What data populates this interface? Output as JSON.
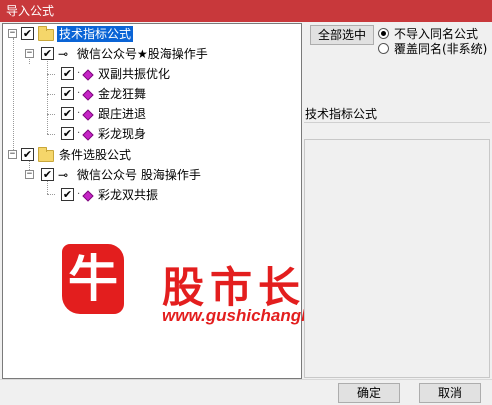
{
  "window": {
    "title": "导入公式"
  },
  "tree": {
    "root1": {
      "label": "技术指标公式",
      "expander": "−",
      "checked": "✔"
    },
    "group1": {
      "label": "微信公众号★股海操作手",
      "expander": "−",
      "checked": "✔"
    },
    "items1": [
      {
        "label": "双副共振优化",
        "checked": "✔"
      },
      {
        "label": "金龙狂舞",
        "checked": "✔"
      },
      {
        "label": "跟庄进退",
        "checked": "✔"
      },
      {
        "label": "彩龙现身",
        "checked": "✔"
      }
    ],
    "root2": {
      "label": "条件选股公式",
      "expander": "−",
      "checked": "✔"
    },
    "group2": {
      "label": "微信公众号 股海操作手",
      "expander": "−",
      "checked": "✔"
    },
    "items2": [
      {
        "label": "彩龙双共振",
        "checked": "✔"
      }
    ]
  },
  "watermark": {
    "logo_char": "牛",
    "title": "股市长红",
    "url": "www.gushichanghong.com"
  },
  "options": {
    "select_all_label": "全部选中",
    "radio1_label": "不导入同名公式",
    "radio2_label": "覆盖同名(非系统)"
  },
  "description": {
    "label": "技术指标公式"
  },
  "footer": {
    "ok_label": "确定",
    "cancel_label": "取消"
  }
}
